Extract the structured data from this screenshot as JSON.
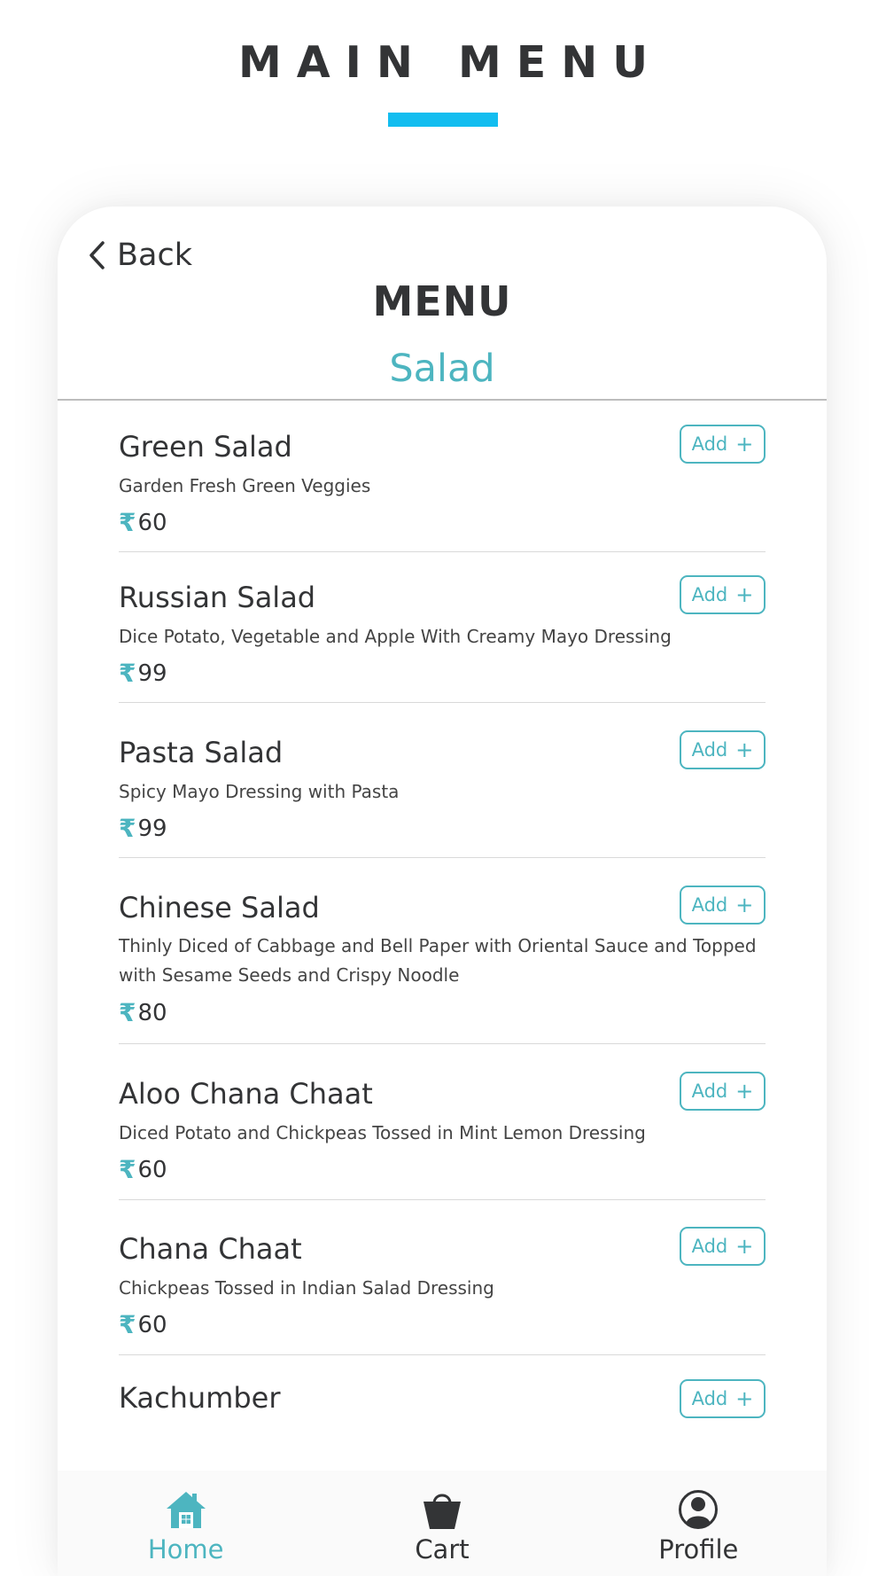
{
  "header": {
    "title": "MAIN MENU"
  },
  "card": {
    "back_label": "Back",
    "title": "MENU",
    "category": "Salad"
  },
  "currency_symbol": "₹",
  "items": [
    {
      "name": "Green Salad",
      "description": "Garden Fresh Green Veggies",
      "price": "60",
      "add_label": "Add"
    },
    {
      "name": "Russian Salad",
      "description": "Dice Potato, Vegetable and Apple With Creamy Mayo Dressing",
      "price": "99",
      "add_label": "Add"
    },
    {
      "name": "Pasta Salad",
      "description": "Spicy Mayo Dressing with Pasta",
      "price": "99",
      "add_label": "Add"
    },
    {
      "name": "Chinese Salad",
      "description": "Thinly Diced of Cabbage and Bell Paper with Oriental Sauce and Topped with Sesame Seeds and Crispy Noodle",
      "price": "80",
      "add_label": "Add"
    },
    {
      "name": "Aloo Chana Chaat",
      "description": "Diced Potato and Chickpeas Tossed in Mint Lemon Dressing",
      "price": "60",
      "add_label": "Add"
    },
    {
      "name": "Chana Chaat",
      "description": "Chickpeas Tossed in Indian Salad Dressing",
      "price": "60",
      "add_label": "Add"
    },
    {
      "name": "Kachumber",
      "add_label": "Add"
    }
  ],
  "bottom_nav": [
    {
      "label": "Home",
      "icon": "home-icon",
      "active": true
    },
    {
      "label": "Cart",
      "icon": "shopping-bag-icon",
      "active": false
    },
    {
      "label": "Profile",
      "icon": "profile-icon",
      "active": false
    }
  ],
  "colors": {
    "accent": "#4db5c0",
    "underline": "#12bdf0",
    "text": "#333436"
  }
}
